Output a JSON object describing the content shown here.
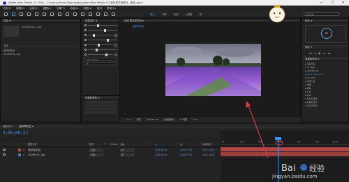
{
  "window": {
    "title": "Adobe After Effects CC 2018 - C:\\Users\\Admin\\Downloads\\Adobe After Effects CC\\薰衣草花田素材 - 副本.aep *",
    "controls": [
      "—",
      "☐",
      "✕"
    ]
  },
  "menu": [
    "文件(F)",
    "编辑(E)",
    "合成(C)",
    "图层(L)",
    "效果(T)",
    "动画(A)",
    "视图(V)",
    "窗口",
    "帮助(H)"
  ],
  "workspaces": [
    "默认",
    "了解",
    "标准",
    "小屏幕",
    "库"
  ],
  "search": {
    "placeholder": "搜索帮助"
  },
  "project": {
    "tab": "项目 ≡",
    "item": "20190916_1...jpg",
    "rows": [
      "名称",
      "薰衣草花田",
      "20190916...jpg"
    ]
  },
  "effects_controls": {
    "tab": "效果控件 ≡",
    "field1": "Tint Colors",
    "field2": "无"
  },
  "presets": {
    "tab": "效果和预设 ≡"
  },
  "composition": {
    "tab": "合成 薰衣草花田 ≡",
    "sub_tab": "薰衣草花田",
    "footer": [
      "50%",
      "完整",
      "0;00;00;22",
      "活动摄像机",
      "1个视图",
      "+0.0"
    ]
  },
  "right_panel": {
    "tab": "信息 ≡",
    "dial_value": "57",
    "preview_tab": "预览 ≡",
    "preset_tab": "效果和预设 ≡",
    "list": [
      "▸ 动画预设",
      "▸ 3D 通道",
      "▸ CINEMA 4D",
      "▸ Boris FX Mocha",
      "▸ Keylight",
      "▸ 实用工具",
      "▸ 扭曲",
      "▸ 抠像",
      "▸ 文本",
      "▸ 时间",
      "▸ 杂色和颗粒",
      "▸ 模糊和锐化",
      "▸ 沉浸式视频"
    ]
  },
  "timeline": {
    "tabs": [
      "渲染队列",
      "薰衣草花田 ≡"
    ],
    "timecode": "0;00;00;22",
    "headers": [
      "图层名称",
      "模式",
      "T",
      "TrkMat",
      "父级",
      "入",
      "出",
      "持续时间"
    ],
    "layers": [
      {
        "num": "1",
        "name": "[薰衣草花田]",
        "mode": "正常",
        "parent": "无",
        "in": "0;00;00;00",
        "out": "0;00;09;29",
        "dur": "0;00;10;00",
        "color": "#c74a4a"
      },
      {
        "num": "2",
        "name": "20190916...jpg",
        "mode": "正常",
        "parent": "无",
        "in": "0;00;00;00",
        "out": "0;00;09;29",
        "dur": "0;00;10;00",
        "color": "#4a7fc7"
      }
    ],
    "ruler": [
      "0f",
      "10f",
      "20f",
      "01;00f",
      "10f",
      "20f",
      "02;00f"
    ]
  },
  "watermark": {
    "text": "jingyan.baidu.com"
  },
  "colors": {
    "accent": "#3f8fe8",
    "track": "#b34747",
    "annotation": "#e23a3a"
  }
}
